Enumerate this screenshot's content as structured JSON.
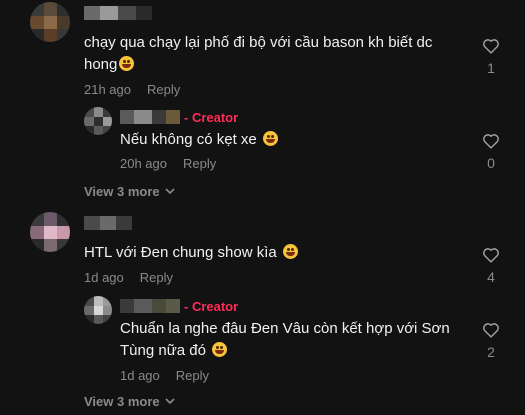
{
  "comments": [
    {
      "text": "chạy qua chạy lại phố đi bộ với cầu bason kh biết dc hong",
      "time": "21h ago",
      "reply_label": "Reply",
      "likes": "1"
    },
    {
      "creator_label": "- Creator",
      "text": "Nếu không có kẹt xe",
      "time": "20h ago",
      "reply_label": "Reply",
      "likes": "0"
    },
    {
      "text": "HTL với Đen chung show kìa",
      "time": "1d ago",
      "reply_label": "Reply",
      "likes": "4"
    },
    {
      "creator_label": "- Creator",
      "text": "Chuẩn la nghe đâu Đen Vâu còn kết hợp với Sơn Tùng nữa đó",
      "time": "1d ago",
      "reply_label": "Reply",
      "likes": "2"
    }
  ],
  "view_more": [
    "View 3 more",
    "View 3 more"
  ],
  "colors": {
    "background": "#121212",
    "creator": "#fe2c55",
    "muted": "#8a8a8a",
    "text": "#f1f1f1"
  },
  "icons": {
    "like": "heart-outline-icon",
    "expand": "chevron-down-icon",
    "emoji": "smiley-emoji-icon"
  }
}
